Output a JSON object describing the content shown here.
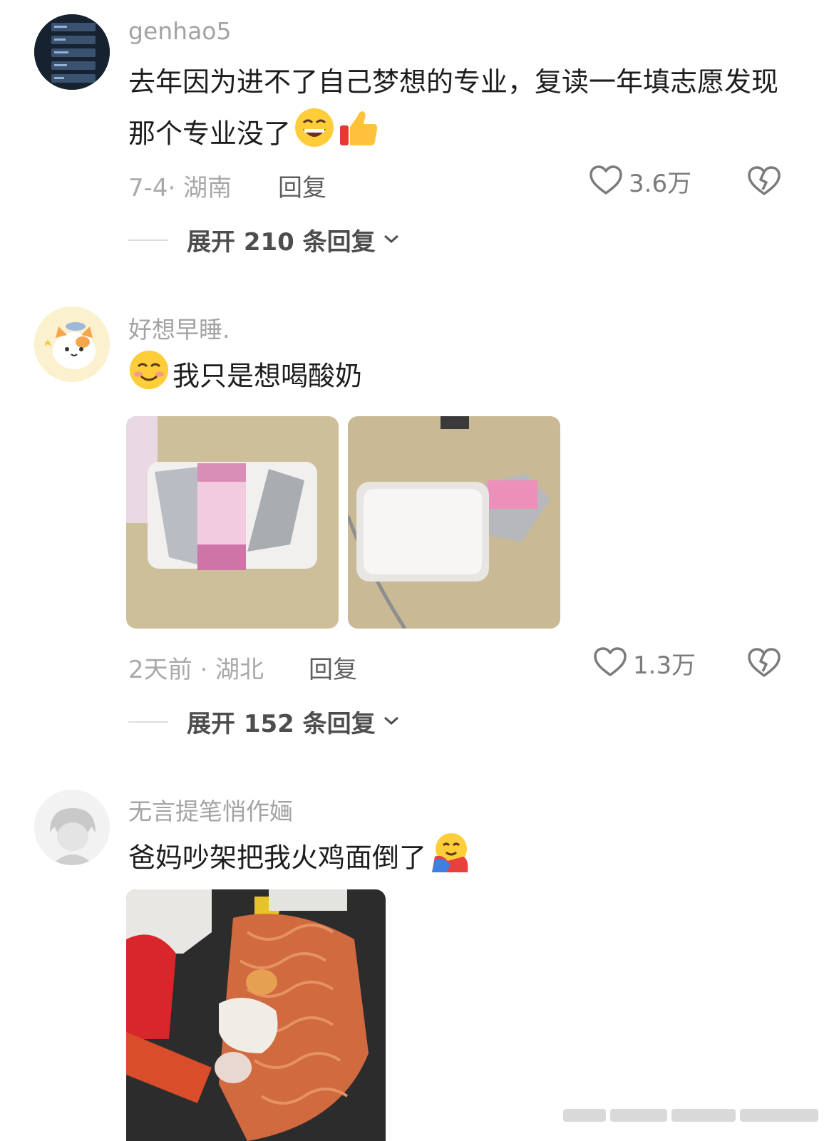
{
  "comments": [
    {
      "username": "genhao5",
      "text": "去年因为进不了自己梦想的专业，复读一年填志愿发现那个专业没了",
      "emojis": [
        "grinning-face-emoji",
        "thumbs-up-emoji"
      ],
      "meta": "7-4· 湖南",
      "reply_label": "回复",
      "likes": "3.6万",
      "expand": "展开 210 条回复"
    },
    {
      "username": "好想早睡.",
      "text": "我只是想喝酸奶",
      "emojis": [
        "smiling-face-emoji"
      ],
      "meta": "2天前 · 湖北",
      "reply_label": "回复",
      "likes": "1.3万",
      "expand": "展开 152 条回复"
    },
    {
      "username": "无言提笔悄作婳",
      "text": "爸妈吵架把我火鸡面倒了",
      "emojis": [
        "hugging-face-emoji"
      ]
    }
  ],
  "colors": {
    "background": "#ffffff",
    "username": "#a3a3a3",
    "text": "#1d1d1d",
    "meta": "#a9a9a9"
  }
}
